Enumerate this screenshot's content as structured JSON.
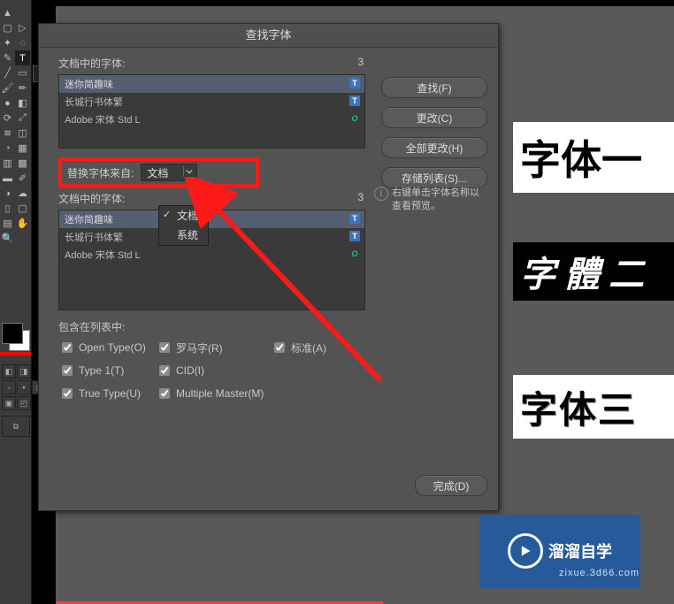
{
  "dialog": {
    "title": "查找字体",
    "fonts_in_doc_label": "文档中的字体:",
    "fonts_count": "3",
    "font_list": [
      {
        "name": "迷你简趣味",
        "badge": "T"
      },
      {
        "name": "长城行书体繁",
        "badge": "T"
      },
      {
        "name": "Adobe 宋体 Std L",
        "badge": "O"
      }
    ],
    "replace_label": "替换字体来自:",
    "replace_source_selected": "文档",
    "replace_options": [
      "文档",
      "系统"
    ],
    "fonts_in_doc_label2": "文档中的字体:",
    "fonts_count2": "3",
    "included_label": "包含在列表中:",
    "checks": {
      "opentype": "Open Type(O)",
      "roman": "罗马字(R)",
      "standard": "标准(A)",
      "type1": "Type 1(T)",
      "cid": "CID(I)",
      "truetype": "True Type(U)",
      "mm": "Multiple Master(M)"
    },
    "buttons": {
      "find": "查找(F)",
      "change": "更改(C)",
      "change_all": "全部更改(H)",
      "save_list": "存储列表(S)...",
      "done": "完成(D)"
    },
    "info_text": "右键单击字体名称以查看预览。"
  },
  "previews": {
    "p1": "字体一",
    "p2": "字 體 二",
    "p3": "字体三"
  },
  "watermark": {
    "brand": "溜溜自学",
    "url": "zixue.3d66.com"
  }
}
